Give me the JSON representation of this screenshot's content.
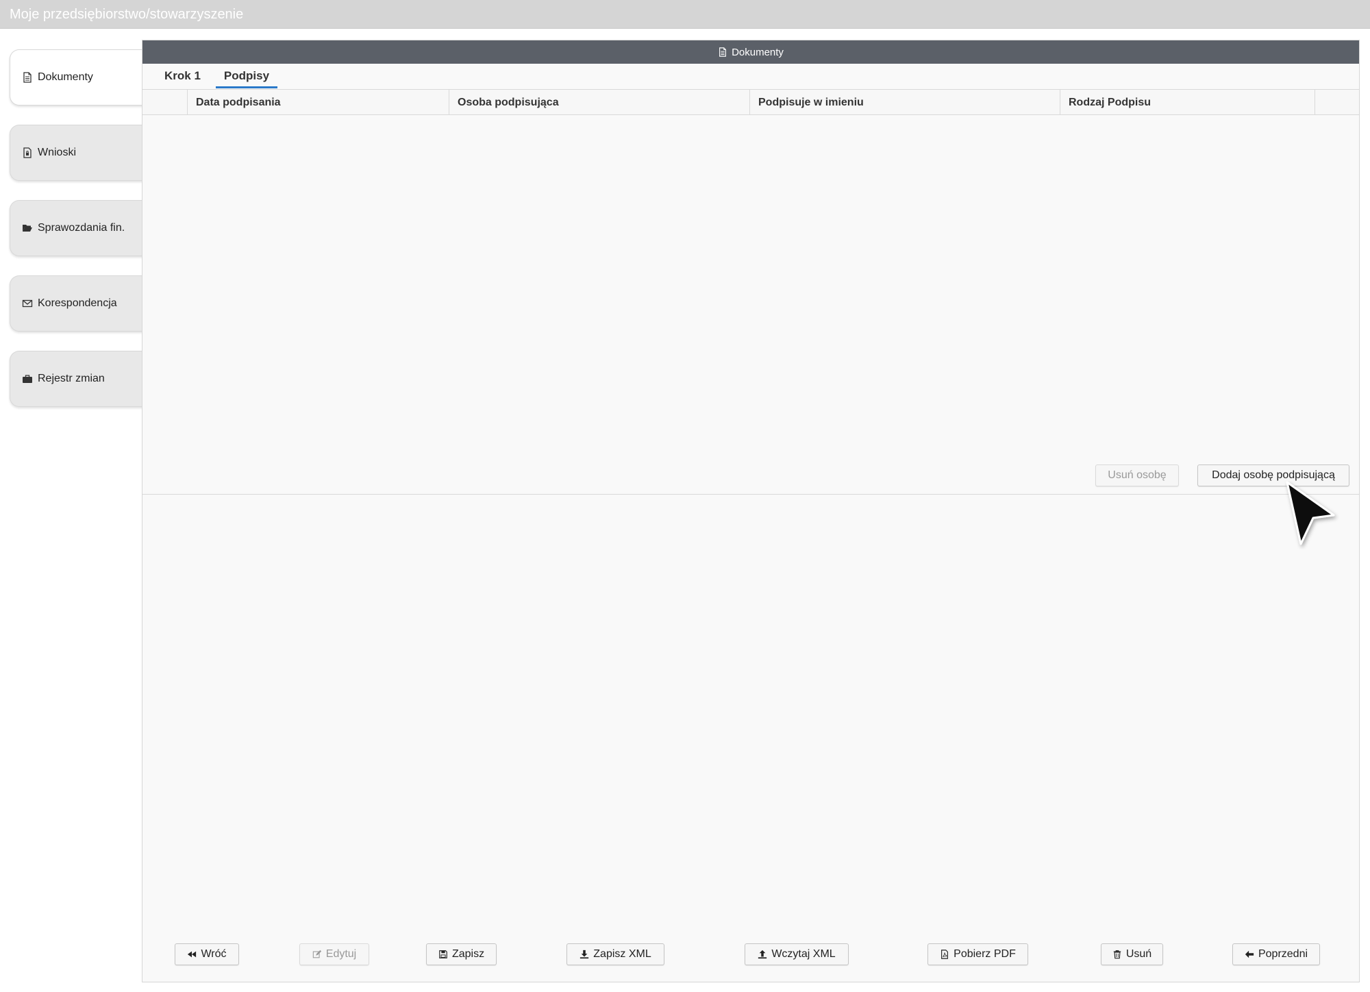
{
  "app": {
    "title": "Moje przedsiębiorstwo/stowarzyszenie"
  },
  "sidebar": {
    "items": [
      {
        "label": "Dokumenty",
        "icon": "document-icon"
      },
      {
        "label": "Wnioski",
        "icon": "document-lock-icon"
      },
      {
        "label": "Sprawozdania fin.",
        "icon": "folder-open-icon"
      },
      {
        "label": "Korespondencja",
        "icon": "envelope-icon"
      },
      {
        "label": "Rejestr zmian",
        "icon": "briefcase-icon"
      }
    ]
  },
  "panel": {
    "title": "Dokumenty",
    "tabs": [
      {
        "label": "Krok 1"
      },
      {
        "label": "Podpisy"
      }
    ],
    "grid": {
      "columns": [
        "Data podpisania",
        "Osoba podpisująca",
        "Podpisuje w imieniu",
        "Rodzaj Podpisu"
      ],
      "rows": []
    },
    "actions": {
      "remove_person": "Usuń osobę",
      "add_signer": "Dodaj osobę podpisującą"
    }
  },
  "footer": {
    "back": "Wróć",
    "edit": "Edytuj",
    "save": "Zapisz",
    "save_xml": "Zapisz XML",
    "load_xml": "Wczytaj XML",
    "download_pdf": "Pobierz PDF",
    "delete": "Usuń",
    "previous": "Poprzedni"
  },
  "colors": {
    "header_bg": "#5b6068",
    "tab_accent": "#2a79c9",
    "topbar_bg": "#d5d5d5"
  }
}
